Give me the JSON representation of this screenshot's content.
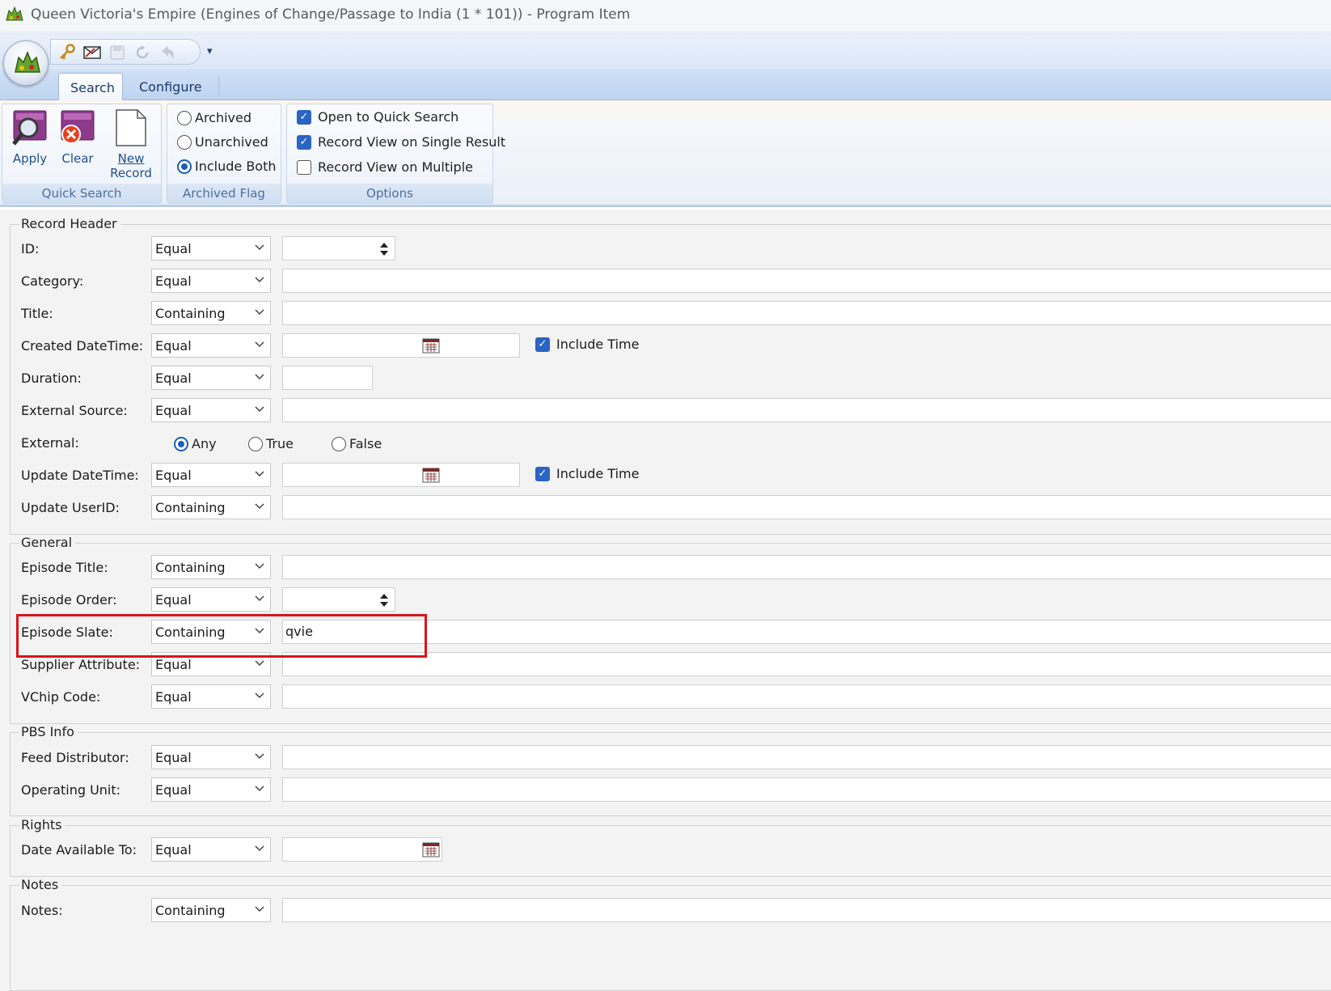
{
  "window": {
    "title": "Queen Victoria's Empire (Engines of Change/Passage to India (1 * 101)) - Program Item"
  },
  "ribbon": {
    "tabs": [
      "Search",
      "Configure"
    ],
    "quick_search": {
      "label": "Quick Search",
      "apply": "Apply",
      "clear": "Clear",
      "new_record_1": "New",
      "new_record_2": "Record"
    },
    "archived_flag": {
      "label": "Archived Flag",
      "options": [
        "Archived",
        "Unarchived",
        "Include Both"
      ],
      "selected": "Include Both"
    },
    "options": {
      "label": "Options",
      "items": [
        {
          "label": "Open to Quick Search",
          "checked": true
        },
        {
          "label": "Record View on Single Result",
          "checked": true
        },
        {
          "label": "Record View on Multiple",
          "checked": false
        }
      ]
    }
  },
  "form": {
    "record_header": {
      "legend": "Record Header",
      "fields": [
        {
          "label": "ID:",
          "operator": "Equal",
          "value": ""
        },
        {
          "label": "Category:",
          "operator": "Equal",
          "value": ""
        },
        {
          "label": "Title:",
          "operator": "Containing",
          "value": ""
        },
        {
          "label": "Created DateTime:",
          "operator": "Equal",
          "value": "",
          "include_time": "Include Time"
        },
        {
          "label": "Duration:",
          "operator": "Equal",
          "value": ""
        },
        {
          "label": "External Source:",
          "operator": "Equal",
          "value": ""
        },
        {
          "label": "External:",
          "options": [
            "Any",
            "True",
            "False"
          ],
          "selected": "Any"
        },
        {
          "label": "Update DateTime:",
          "operator": "Equal",
          "value": "",
          "include_time": "Include Time"
        },
        {
          "label": "Update UserID:",
          "operator": "Containing",
          "value": ""
        }
      ]
    },
    "general": {
      "legend": "General",
      "fields": [
        {
          "label": "Episode Title:",
          "operator": "Containing",
          "value": ""
        },
        {
          "label": "Episode Order:",
          "operator": "Equal",
          "value": ""
        },
        {
          "label": "Episode Slate:",
          "operator": "Containing",
          "value": "qvie"
        },
        {
          "label": "Supplier Attribute:",
          "operator": "Equal",
          "value": ""
        },
        {
          "label": "VChip Code:",
          "operator": "Equal",
          "value": ""
        }
      ]
    },
    "pbs_info": {
      "legend": "PBS Info",
      "fields": [
        {
          "label": "Feed Distributor:",
          "operator": "Equal",
          "value": ""
        },
        {
          "label": "Operating Unit:",
          "operator": "Equal",
          "value": ""
        }
      ]
    },
    "rights": {
      "legend": "Rights",
      "fields": [
        {
          "label": "Date Available To:",
          "operator": "Equal",
          "value": ""
        }
      ]
    },
    "notes": {
      "legend": "Notes",
      "fields": [
        {
          "label": "Notes:",
          "operator": "Containing",
          "value": ""
        }
      ]
    }
  },
  "colors": {
    "highlight_box": "#d9141b",
    "accent": "#2a64c4",
    "ribbon_text": "#1e4e8c"
  },
  "icons": [
    "app-logo-icon",
    "key-icon",
    "mail-icon",
    "save-icon",
    "refresh-icon",
    "undo-icon",
    "search-magnifier-icon",
    "clear-icon",
    "new-document-icon",
    "chevron-down-icon",
    "spinner-icon",
    "calendar-icon"
  ]
}
